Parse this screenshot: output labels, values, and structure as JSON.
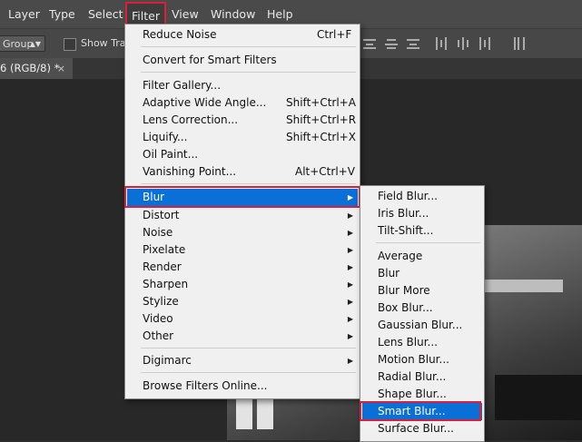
{
  "menubar": {
    "items": [
      "Layer",
      "Type",
      "Select",
      "Filter",
      "View",
      "Window",
      "Help"
    ],
    "active": "Filter"
  },
  "options_bar": {
    "group_select": "Group",
    "show_transform_label": "Show Tran:"
  },
  "document_tab": {
    "label": "6 (RGB/8) *",
    "close": "×"
  },
  "filter_menu": {
    "items": [
      {
        "label": "Reduce Noise",
        "shortcut": "Ctrl+F"
      },
      {
        "label": "Convert for Smart Filters"
      },
      {
        "label": "Filter Gallery..."
      },
      {
        "label": "Adaptive Wide Angle...",
        "shortcut": "Shift+Ctrl+A"
      },
      {
        "label": "Lens Correction...",
        "shortcut": "Shift+Ctrl+R"
      },
      {
        "label": "Liquify...",
        "shortcut": "Shift+Ctrl+X"
      },
      {
        "label": "Oil Paint..."
      },
      {
        "label": "Vanishing Point...",
        "shortcut": "Alt+Ctrl+V"
      },
      {
        "label": "Blur",
        "submenu": true
      },
      {
        "label": "Distort",
        "submenu": true
      },
      {
        "label": "Noise",
        "submenu": true
      },
      {
        "label": "Pixelate",
        "submenu": true
      },
      {
        "label": "Render",
        "submenu": true
      },
      {
        "label": "Sharpen",
        "submenu": true
      },
      {
        "label": "Stylize",
        "submenu": true
      },
      {
        "label": "Video",
        "submenu": true
      },
      {
        "label": "Other",
        "submenu": true
      },
      {
        "label": "Digimarc",
        "submenu": true
      },
      {
        "label": "Browse Filters Online..."
      }
    ]
  },
  "blur_submenu": {
    "items": [
      "Field Blur...",
      "Iris Blur...",
      "Tilt-Shift...",
      "Average",
      "Blur",
      "Blur More",
      "Box Blur...",
      "Gaussian Blur...",
      "Lens Blur...",
      "Motion Blur...",
      "Radial Blur...",
      "Shape Blur...",
      "Smart Blur...",
      "Surface Blur..."
    ],
    "selected": "Smart Blur..."
  },
  "colors": {
    "highlight": "#0a6fd6",
    "annotation": "#d8203a"
  }
}
